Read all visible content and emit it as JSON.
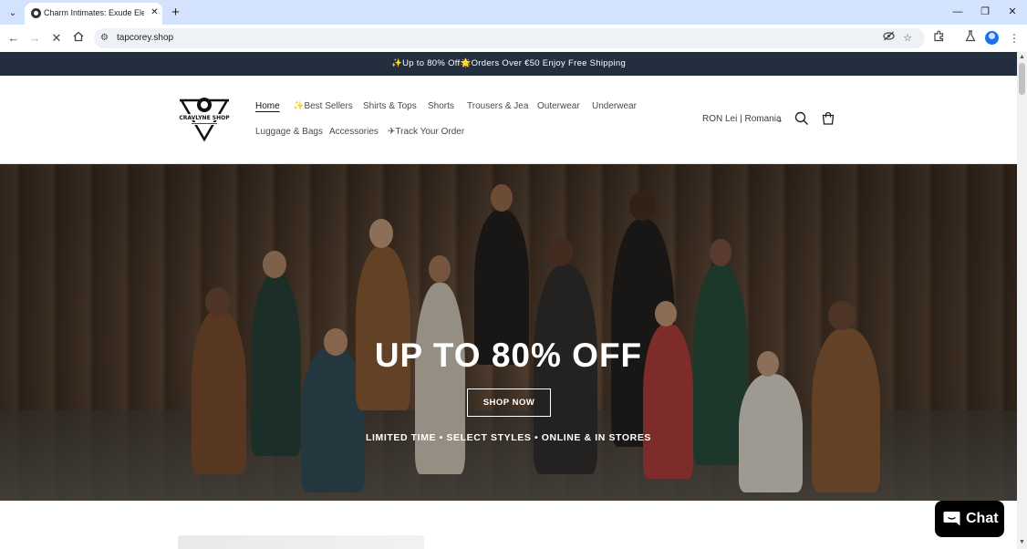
{
  "browser": {
    "tab_title": "Charm Intimates: Exude Elegance",
    "new_tab_icon": "plus-icon",
    "url": "tapcorey.shop"
  },
  "announcement": {
    "text": "✨Up to 80% Off🌟Orders Over €50 Enjoy Free Shipping"
  },
  "header": {
    "logo_alt": "brand-logo",
    "nav": [
      {
        "label": "Home",
        "active": true
      },
      {
        "label": "✨Best Sellers"
      },
      {
        "label": "Shirts & Tops"
      },
      {
        "label": "Shorts"
      },
      {
        "label": "Trousers & Jea"
      },
      {
        "label": "Outerwear"
      },
      {
        "label": "Underwear"
      },
      {
        "label": "Luggage & Bags"
      },
      {
        "label": "Accessories"
      },
      {
        "label": "✈Track Your Order"
      }
    ],
    "country_selector": "RON Lei | Romania"
  },
  "hero": {
    "heading": "UP TO 80% OFF",
    "button_label": "SHOP NOW",
    "subtext": "LIMITED TIME • SELECT STYLES • ONLINE & IN STORES"
  },
  "chat": {
    "label": "Chat"
  },
  "colors": {
    "announcement_bg": "#232f3e",
    "chrome_tabbar": "#d3e3fd",
    "chat_bg": "#000000"
  }
}
